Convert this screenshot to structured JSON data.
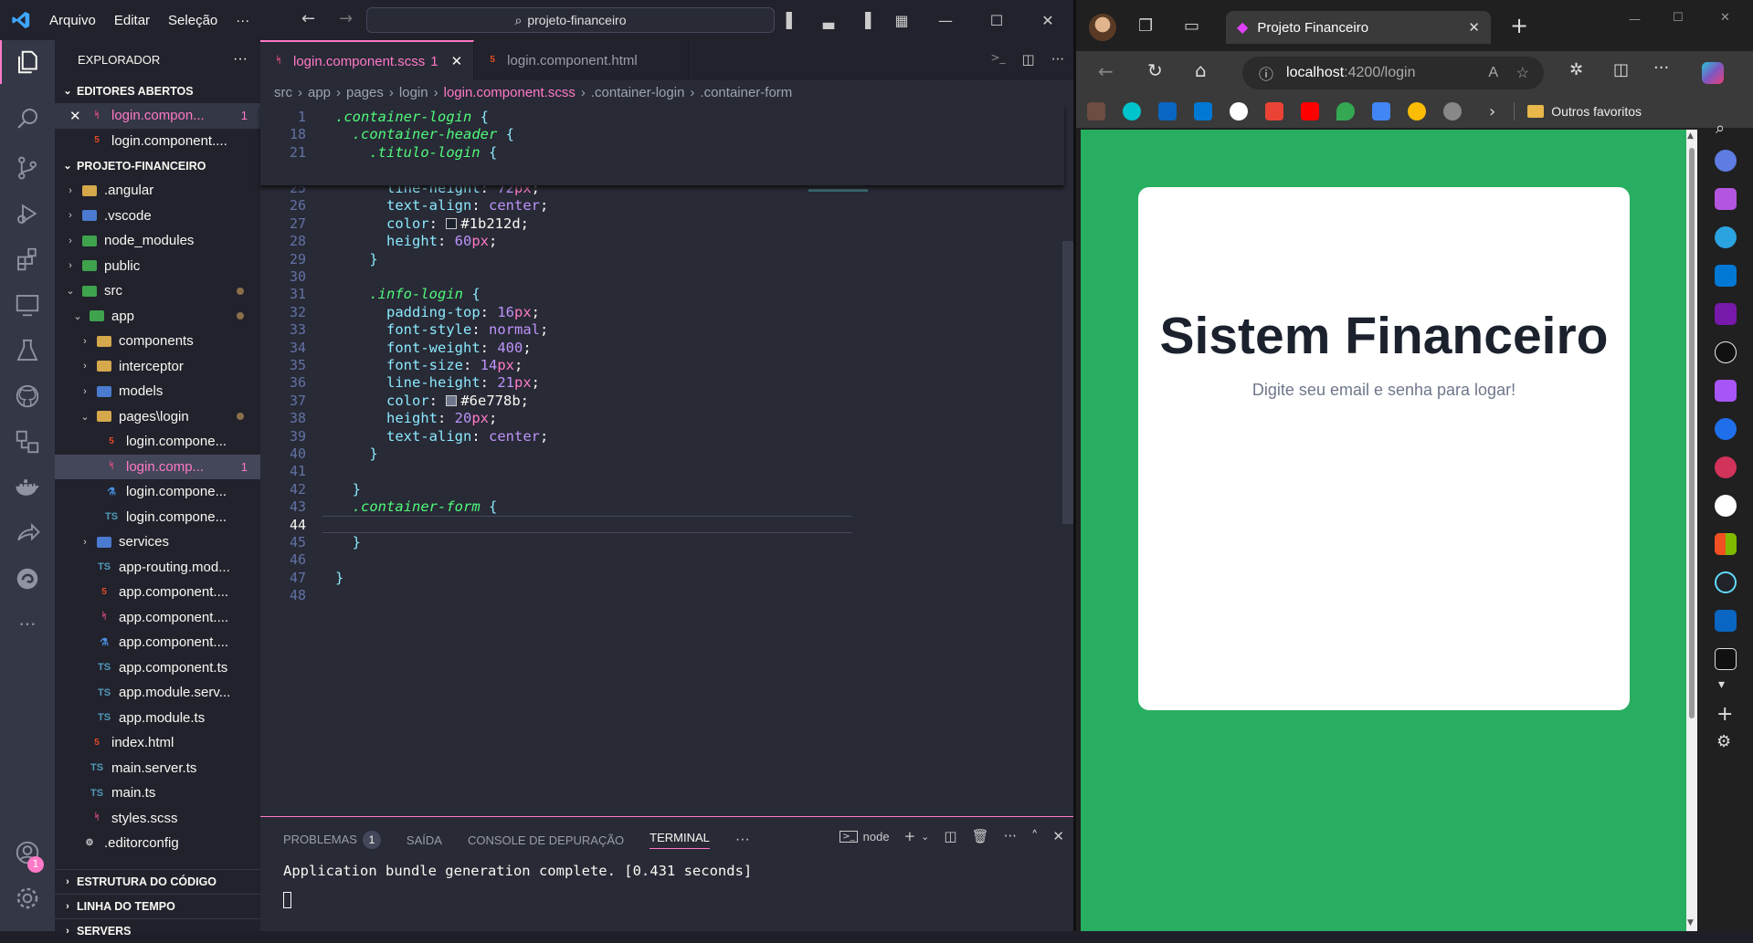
{
  "vscode": {
    "menu": [
      "Arquivo",
      "Editar",
      "Seleção",
      "···"
    ],
    "search": "projeto-financeiro",
    "explorer_title": "EXPLORADOR",
    "sections": {
      "open_editors": "EDITORES ABERTOS",
      "project": "PROJETO-FINANCEIRO",
      "outline": "ESTRUTURA DO CÓDIGO",
      "timeline": "LINHA DO TEMPO",
      "servers": "SERVERS"
    },
    "open_editors": [
      {
        "name": "login.compon...",
        "badge": "1",
        "icon": "scss"
      },
      {
        "name": "login.component....",
        "icon": "html"
      }
    ],
    "tree": [
      {
        "name": ".angular",
        "depth": 1,
        "type": "folder",
        "chev": "›"
      },
      {
        "name": ".vscode",
        "depth": 1,
        "type": "folder-blue",
        "chev": "›"
      },
      {
        "name": "node_modules",
        "depth": 1,
        "type": "folder-green",
        "chev": "›"
      },
      {
        "name": "public",
        "depth": 1,
        "type": "folder-green",
        "chev": "›"
      },
      {
        "name": "src",
        "depth": 1,
        "type": "folder-green",
        "chev": "⌄",
        "dot": true
      },
      {
        "name": "app",
        "depth": 2,
        "type": "folder-green",
        "chev": "⌄",
        "dot": true
      },
      {
        "name": "components",
        "depth": 3,
        "type": "folder",
        "chev": "›"
      },
      {
        "name": "interceptor",
        "depth": 3,
        "type": "folder",
        "chev": "›"
      },
      {
        "name": "models",
        "depth": 3,
        "type": "folder-blue",
        "chev": "›"
      },
      {
        "name": "pages\\login",
        "depth": 3,
        "type": "folder",
        "chev": "⌄",
        "dot": true
      },
      {
        "name": "login.compone...",
        "depth": 4,
        "type": "html"
      },
      {
        "name": "login.comp...",
        "depth": 4,
        "type": "scss",
        "badge": "1",
        "selected": true
      },
      {
        "name": "login.compone...",
        "depth": 4,
        "type": "spec"
      },
      {
        "name": "login.compone...",
        "depth": 4,
        "type": "ts"
      },
      {
        "name": "services",
        "depth": 3,
        "type": "folder-blue",
        "chev": "›"
      },
      {
        "name": "app-routing.mod...",
        "depth": 3,
        "type": "ts"
      },
      {
        "name": "app.component....",
        "depth": 3,
        "type": "html"
      },
      {
        "name": "app.component....",
        "depth": 3,
        "type": "scss"
      },
      {
        "name": "app.component....",
        "depth": 3,
        "type": "spec"
      },
      {
        "name": "app.component.ts",
        "depth": 3,
        "type": "ts"
      },
      {
        "name": "app.module.serv...",
        "depth": 3,
        "type": "ts"
      },
      {
        "name": "app.module.ts",
        "depth": 3,
        "type": "ts"
      },
      {
        "name": "index.html",
        "depth": 2,
        "type": "html"
      },
      {
        "name": "main.server.ts",
        "depth": 2,
        "type": "ts"
      },
      {
        "name": "main.ts",
        "depth": 2,
        "type": "ts"
      },
      {
        "name": "styles.scss",
        "depth": 2,
        "type": "scss"
      },
      {
        "name": ".editorconfig",
        "depth": 1,
        "type": "gear"
      }
    ],
    "tabs": [
      {
        "label": "login.component.scss",
        "badge": "1",
        "active": true
      },
      {
        "label": "login.component.html",
        "active": false
      }
    ],
    "breadcrumbs": [
      "src",
      "app",
      "pages",
      "login",
      "login.component.scss",
      ".container-login",
      ".container-form"
    ],
    "sticky_lines": [
      {
        "n": "1",
        "text": ".container-login {"
      },
      {
        "n": "18",
        "text": "  .container-header {"
      },
      {
        "n": "21",
        "text": "    .titulo-login {"
      }
    ],
    "code_lines": [
      {
        "n": "25",
        "text": "      line-height: 72px;"
      },
      {
        "n": "26",
        "text": "      text-align: center;"
      },
      {
        "n": "27",
        "text": "      color: #1b212d;"
      },
      {
        "n": "28",
        "text": "      height: 60px;"
      },
      {
        "n": "29",
        "text": "    }"
      },
      {
        "n": "30",
        "text": ""
      },
      {
        "n": "31",
        "text": "    .info-login {"
      },
      {
        "n": "32",
        "text": "      padding-top: 16px;"
      },
      {
        "n": "33",
        "text": "      font-style: normal;"
      },
      {
        "n": "34",
        "text": "      font-weight: 400;"
      },
      {
        "n": "35",
        "text": "      font-size: 14px;"
      },
      {
        "n": "36",
        "text": "      line-height: 21px;"
      },
      {
        "n": "37",
        "text": "      color: #6e778b;"
      },
      {
        "n": "38",
        "text": "      height: 20px;"
      },
      {
        "n": "39",
        "text": "      text-align: center;"
      },
      {
        "n": "40",
        "text": "    }"
      },
      {
        "n": "41",
        "text": ""
      },
      {
        "n": "42",
        "text": "  }"
      },
      {
        "n": "43",
        "text": "  .container-form {"
      },
      {
        "n": "44",
        "text": ""
      },
      {
        "n": "45",
        "text": "  }"
      },
      {
        "n": "46",
        "text": ""
      },
      {
        "n": "47",
        "text": "}"
      },
      {
        "n": "48",
        "text": ""
      }
    ],
    "panel": {
      "tabs": [
        "PROBLEMAS",
        "SAÍDA",
        "CONSOLE DE DEPURAÇÃO",
        "TERMINAL"
      ],
      "problems_count": "1",
      "terminal_name": "node",
      "output": "Application bundle generation complete. [0.431 seconds]"
    },
    "account_badge": "1"
  },
  "browser": {
    "tab_title": "Projeto Financeiro",
    "url_host": "localhost",
    "url_path": ":4200/login",
    "bookmarks_folder": "Outros favoritos",
    "page": {
      "title": "Sistem Financeiro",
      "subtitle": "Digite seu email e senha para logar!",
      "bg_color": "#27ae60"
    }
  }
}
